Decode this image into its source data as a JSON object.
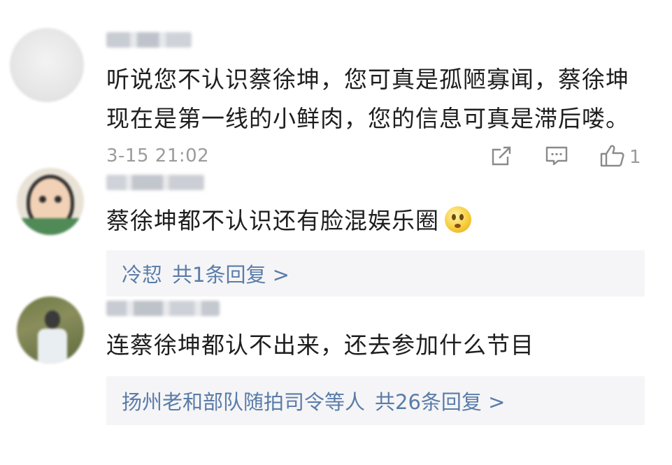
{
  "comments": [
    {
      "text_lines": [
        "听说您不认识蔡徐坤，您可真是孤陋寡闻，蔡徐坤",
        "现在是第一线的小鲜肉，您的信息可真是滞后喽。"
      ],
      "time": "3-15 21:02",
      "like_count": "1"
    },
    {
      "text": "蔡徐坤都不认识还有脸混娱乐圈",
      "reply_names": "冷恝",
      "reply_count": "共1条回复 >"
    },
    {
      "text": "连蔡徐坤都认不出来，还去参加什么节目",
      "reply_names": "扬州老和部队随拍司令等人",
      "reply_count": "共26条回复 >"
    }
  ],
  "icons": {
    "share": "share-icon",
    "comment": "comment-icon",
    "like": "thumbs-up-icon",
    "emoji": "thinking-face-emoji"
  },
  "colors": {
    "reply_link": "#5a7ca8",
    "meta": "#9b9b9b",
    "reply_bg": "#f5f5f7"
  }
}
